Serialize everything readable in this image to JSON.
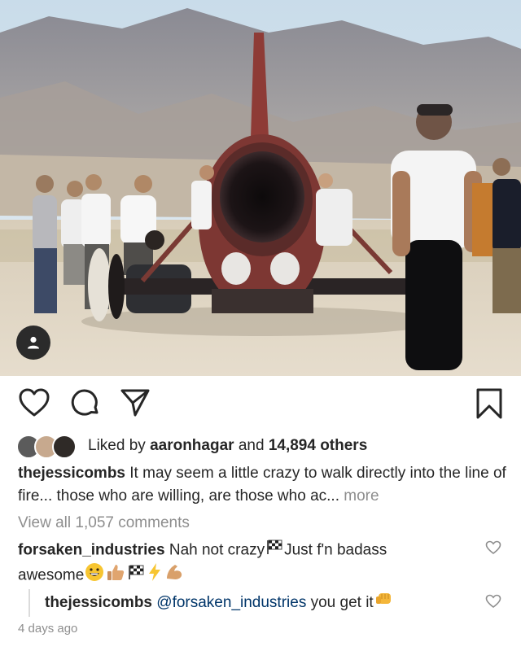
{
  "post": {
    "liked_by_prefix": "Liked by",
    "liked_by_user": "aaronhagar",
    "liked_by_and": "and",
    "likes_others": "14,894 others",
    "caption_user": "thejessicombs",
    "caption_text": "It may seem a little crazy to walk directly into the line of fire... those who are willing, are those who ac...",
    "more_label": "more",
    "view_all_comments": "View all 1,057 comments",
    "time_ago": "4 days ago"
  },
  "comments": [
    {
      "user": "forsaken_industries",
      "text_1": "Nah not crazy",
      "text_2": "Just f'n badass",
      "text_3": "awesome"
    }
  ],
  "reply": {
    "user": "thejessicombs",
    "mention": "@forsaken_industries",
    "text": "you get it"
  },
  "icons": {
    "heart": "heart-icon",
    "comment": "comment-icon",
    "share": "send-icon",
    "save": "bookmark-icon",
    "tag": "person-tag-icon"
  },
  "colors": {
    "text": "#262626",
    "muted": "#8e8e8e",
    "mention": "#003569"
  }
}
